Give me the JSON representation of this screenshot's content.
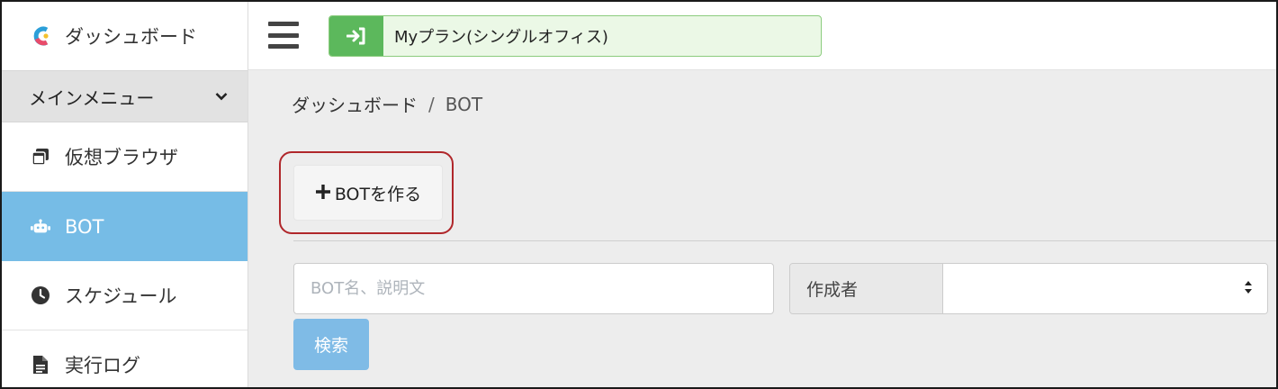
{
  "brand": {
    "title": "ダッシュボード"
  },
  "sidebar": {
    "menu_header": "メインメニュー",
    "items": [
      {
        "label": "仮想ブラウザ",
        "icon": "browser-windows-icon"
      },
      {
        "label": "BOT",
        "icon": "robot-icon",
        "active": true
      },
      {
        "label": "スケジュール",
        "icon": "clock-icon"
      },
      {
        "label": "実行ログ",
        "icon": "document-icon"
      }
    ]
  },
  "topbar": {
    "plan_label": "Myプラン(シングルオフィス)"
  },
  "breadcrumb": {
    "home": "ダッシュボード",
    "separator": "/",
    "current": "BOT"
  },
  "main": {
    "create_button_label": "BOTを作る",
    "search_placeholder": "BOT名、説明文",
    "author_label": "作成者",
    "author_value": "",
    "search_button_label": "検索"
  },
  "colors": {
    "active_nav": "#76bce6",
    "plan_icon_bg": "#5cb85c",
    "plan_bg": "#ebf8e6",
    "highlight_border": "#b0272b",
    "search_button": "#7fbbe6"
  }
}
